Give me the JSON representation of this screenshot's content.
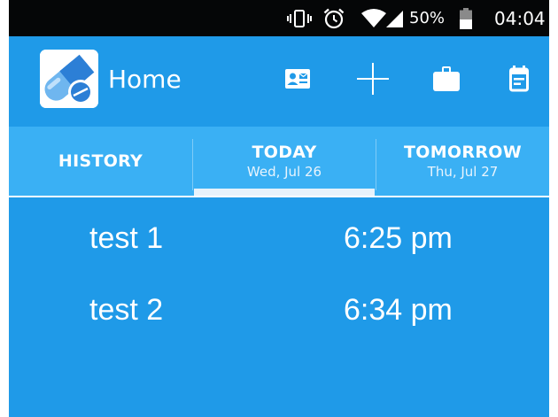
{
  "status_bar": {
    "battery_percent": "50%",
    "time": "04:04",
    "icons": [
      "vibrate-icon",
      "alarm-icon",
      "wifi-icon",
      "signal-icon",
      "battery-icon"
    ]
  },
  "app_bar": {
    "title": "Home",
    "logo_icon": "pill-capsule-icon",
    "actions": [
      "contact-card-icon",
      "plus-icon",
      "briefcase-icon",
      "calendar-icon"
    ]
  },
  "tabs": [
    {
      "label": "HISTORY",
      "sub": ""
    },
    {
      "label": "TODAY",
      "sub": "Wed, Jul 26"
    },
    {
      "label": "TOMORROW",
      "sub": "Thu, Jul 27"
    }
  ],
  "selected_tab": "TODAY",
  "doses": [
    {
      "name": "test 1",
      "time": "6:25 pm"
    },
    {
      "name": "test 2",
      "time": "6:34 pm"
    }
  ],
  "colors": {
    "primary": "#1f9ae8",
    "tab_bar": "#3ab0f4",
    "status_bar": "#050607",
    "text": "#ffffff"
  }
}
